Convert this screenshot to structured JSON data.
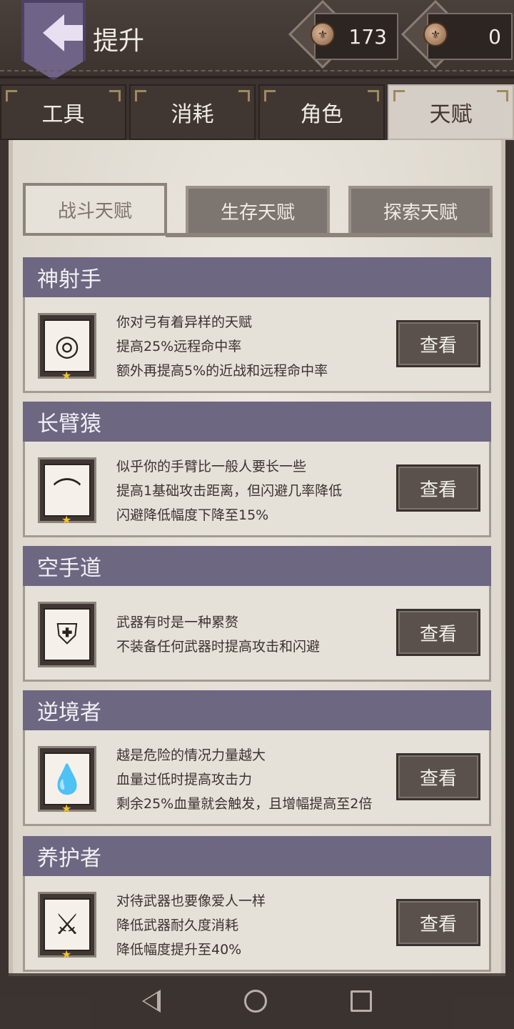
{
  "header": {
    "title": "提升",
    "currency_1": "173",
    "currency_2": "0"
  },
  "main_tabs": [
    "工具",
    "消耗",
    "角色",
    "天赋"
  ],
  "sub_tabs": [
    "战斗天赋",
    "生存天赋",
    "探索天赋"
  ],
  "talents": [
    {
      "name": "神射手",
      "icon": "target-arrows-icon",
      "lines": [
        "你对弓有着异样的天赋",
        "提高25%远程命中率",
        "额外再提高5%的近战和远程命中率"
      ],
      "button": "查看"
    },
    {
      "name": "长臂猿",
      "icon": "long-arm-icon",
      "lines": [
        "似乎你的手臂比一般人要长一些",
        "提高1基础攻击距离，但闪避几率降低",
        "闪避降低幅度下降至15%"
      ],
      "button": "查看"
    },
    {
      "name": "空手道",
      "icon": "karate-gi-icon",
      "lines": [
        "武器有时是一种累赘",
        "不装备任何武器时提高攻击和闪避"
      ],
      "button": "查看"
    },
    {
      "name": "逆境者",
      "icon": "blood-drop-icon",
      "lines": [
        "越是危险的情况力量越大",
        "血量过低时提高攻击力",
        "剩余25%血量就会触发，且增幅提高至2倍"
      ],
      "button": "查看"
    },
    {
      "name": "养护者",
      "icon": "weapon-care-icon",
      "lines": [
        "对待武器也要像爱人一样",
        "降低武器耐久度消耗",
        "降低幅度提升至40%"
      ],
      "button": "查看"
    }
  ]
}
